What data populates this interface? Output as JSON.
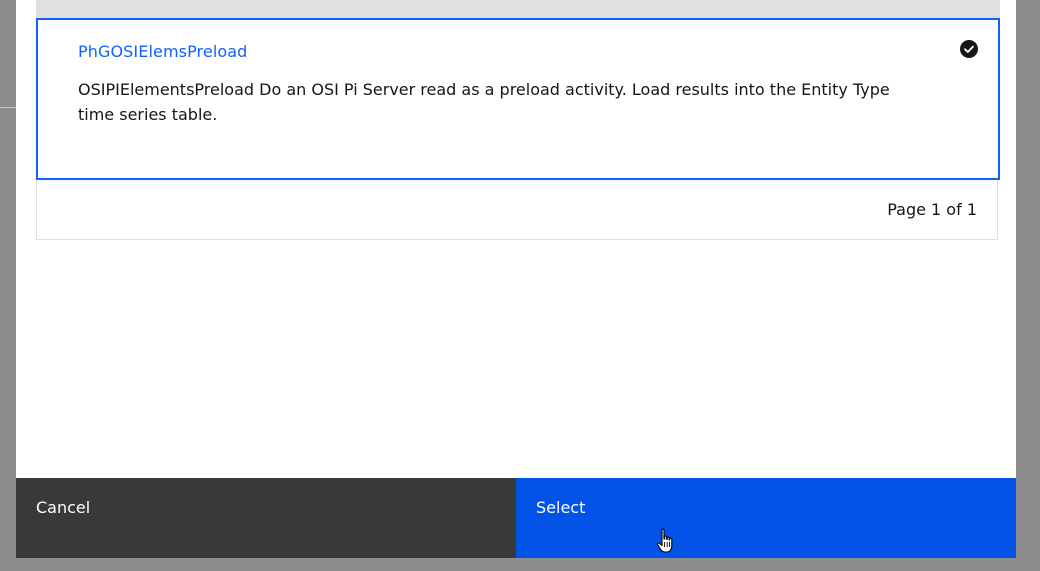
{
  "item": {
    "title": "PhGOSIElemsPreload",
    "description": "OSIPIElementsPreload Do an OSI Pi Server read as a preload activity. Load results into the Entity Type time series table.",
    "selected": true
  },
  "pagination": {
    "text": "Page 1 of 1"
  },
  "footer": {
    "cancel_label": "Cancel",
    "select_label": "Select"
  },
  "colors": {
    "accent": "#0f62fe",
    "primary_button": "#0353e9",
    "secondary_button": "#393939",
    "overlay": "#8d8d8d"
  },
  "icons": {
    "selected": "checkmark-filled-icon",
    "cursor": "hand-pointer-icon"
  }
}
